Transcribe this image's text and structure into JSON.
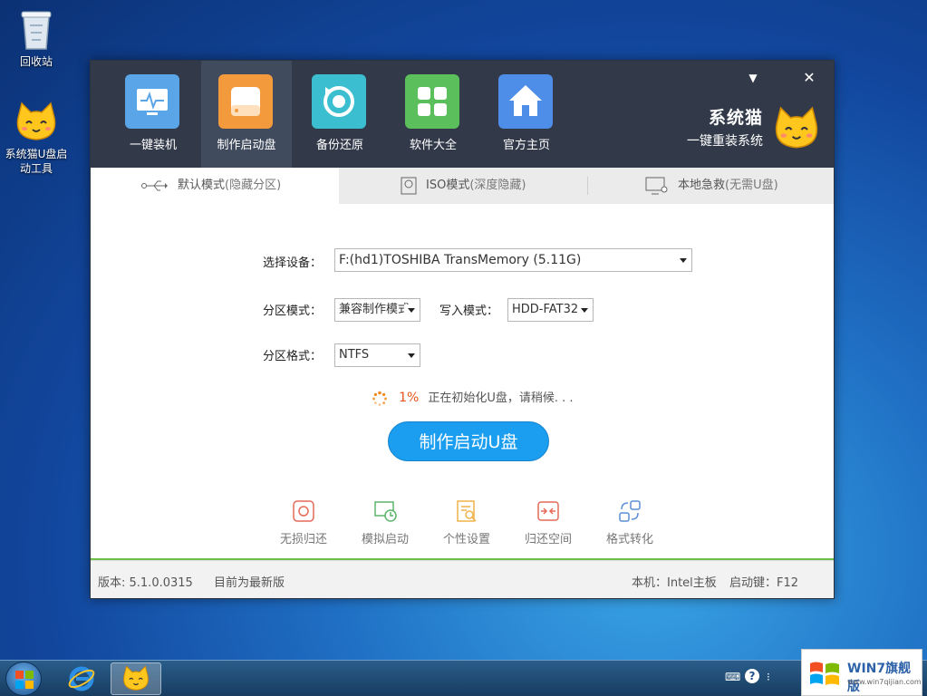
{
  "desktop": {
    "icons": [
      {
        "label": "回收站"
      },
      {
        "label": "系统猫U盘启动工具"
      }
    ]
  },
  "window": {
    "nav": [
      {
        "label": "一键装机",
        "icon": "monitor-pulse-icon",
        "color": "#5aa5e8"
      },
      {
        "label": "制作启动盘",
        "icon": "usb-drive-icon",
        "color": "#f39a3c"
      },
      {
        "label": "备份还原",
        "icon": "restore-icon",
        "color": "#3bbfd0"
      },
      {
        "label": "软件大全",
        "icon": "grid-icon",
        "color": "#5bc05b"
      },
      {
        "label": "官方主页",
        "icon": "home-icon",
        "color": "#4f8ee8"
      }
    ],
    "brand": {
      "name": "系统猫",
      "tagline": "一键重装系统"
    },
    "controls": {
      "menu": "▼",
      "close": "✕"
    },
    "tabs": [
      {
        "label": "默认模式",
        "note": "(隐藏分区)"
      },
      {
        "label": "ISO模式",
        "note": "(深度隐藏)"
      },
      {
        "label": "本地急救",
        "note": "(无需U盘)"
      }
    ],
    "form": {
      "device_label": "选择设备：",
      "device_value": "F:(hd1)TOSHIBA TransMemory (5.11G)",
      "partition_mode_label": "分区模式：",
      "partition_mode_value": "兼容制作模式",
      "write_mode_label": "写入模式：",
      "write_mode_value": "HDD-FAT32",
      "partition_format_label": "分区格式：",
      "partition_format_value": "NTFS"
    },
    "progress": {
      "percent_text": "1%",
      "percent": 1,
      "status": "正在初始化U盘，请稍候. . ."
    },
    "make_button": "制作启动U盘",
    "tools": [
      {
        "label": "无损归还",
        "icon": "lossless-restore-icon"
      },
      {
        "label": "模拟启动",
        "icon": "simulate-boot-icon"
      },
      {
        "label": "个性设置",
        "icon": "personalize-icon"
      },
      {
        "label": "归还空间",
        "icon": "return-space-icon"
      },
      {
        "label": "格式转化",
        "icon": "format-convert-icon"
      }
    ],
    "footer": {
      "version": "版本: 5.1.0.0315",
      "update_status": "目前为最新版",
      "machine": "本机：Intel主板",
      "boot_key": "启动键：F12"
    }
  },
  "badge": {
    "title": "WIN7旗舰版",
    "url": "www.win7qijian.com"
  },
  "colors": {
    "header": "#323a4a",
    "accent": "#1b9ef0",
    "progress": "#e8541a",
    "tool_icon": "#e66a5a"
  }
}
